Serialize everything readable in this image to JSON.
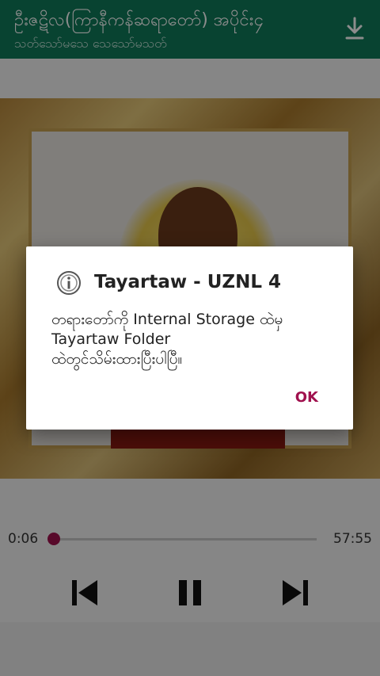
{
  "appbar": {
    "title": "ဦးဇဋိလ(ကြာနီကန်ဆရာတော်) အပိုင်း၄",
    "subtitle": "သတ်သော်မသေ သေသော်မသတ်",
    "download_icon": "download-icon"
  },
  "player": {
    "elapsed": "0:06",
    "total": "57:55",
    "progress_fraction": 0.0017,
    "prev_icon": "skip-previous-icon",
    "pause_icon": "pause-icon",
    "next_icon": "skip-next-icon"
  },
  "dialog": {
    "icon": "info-icon",
    "title": "Tayartaw - UZNL 4",
    "message_line1": "တရားတော်ကို Internal Storage ထဲမှ",
    "message_line2": "Tayartaw Folder",
    "message_line3": "ထဲတွင်သိမ်းထားပြီးပါပြီ။",
    "ok_label": "OK"
  },
  "colors": {
    "appbar": "#0f7a5a",
    "accent": "#a0114e"
  }
}
